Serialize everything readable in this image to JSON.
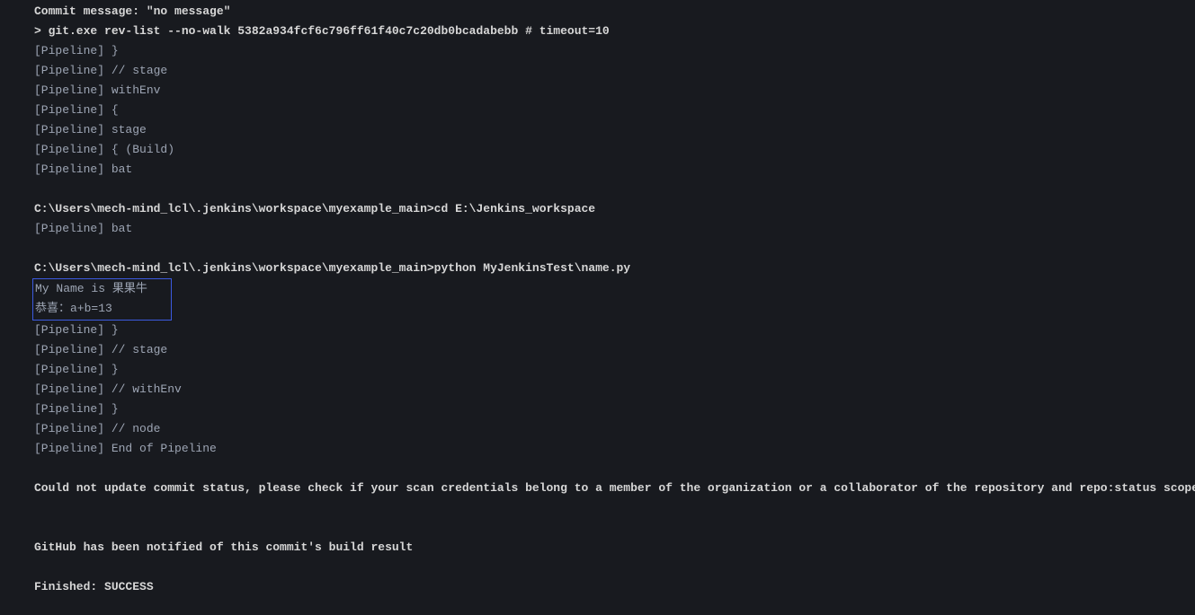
{
  "console": {
    "lines": [
      {
        "text": "Commit message: \"no message\"",
        "style": "bold-white"
      },
      {
        "text": " > git.exe rev-list --no-walk 5382a934fcf6c796ff61f40c7c20db0bcadabebb # timeout=10",
        "style": "bold-white"
      },
      {
        "text": "[Pipeline] }",
        "style": "normal"
      },
      {
        "text": "[Pipeline] // stage",
        "style": "normal"
      },
      {
        "text": "[Pipeline] withEnv",
        "style": "normal"
      },
      {
        "text": "[Pipeline] {",
        "style": "normal"
      },
      {
        "text": "[Pipeline] stage",
        "style": "normal"
      },
      {
        "text": "[Pipeline] { (Build)",
        "style": "normal"
      },
      {
        "text": "[Pipeline] bat",
        "style": "normal"
      },
      {
        "text": "",
        "style": "normal"
      },
      {
        "text": "C:\\Users\\mech-mind_lcl\\.jenkins\\workspace\\myexample_main>cd E:\\Jenkins_workspace ",
        "style": "bold-white"
      },
      {
        "text": "[Pipeline] bat",
        "style": "normal"
      },
      {
        "text": "",
        "style": "normal"
      },
      {
        "text": "C:\\Users\\mech-mind_lcl\\.jenkins\\workspace\\myexample_main>python MyJenkinsTest\\name.py ",
        "style": "bold-white"
      }
    ],
    "highlighted": [
      "My Name is 果果牛",
      "恭喜：a+b=13"
    ],
    "lines_after": [
      {
        "text": "[Pipeline] }",
        "style": "normal"
      },
      {
        "text": "[Pipeline] // stage",
        "style": "normal"
      },
      {
        "text": "[Pipeline] }",
        "style": "normal"
      },
      {
        "text": "[Pipeline] // withEnv",
        "style": "normal"
      },
      {
        "text": "[Pipeline] }",
        "style": "normal"
      },
      {
        "text": "[Pipeline] // node",
        "style": "normal"
      },
      {
        "text": "[Pipeline] End of Pipeline",
        "style": "normal"
      },
      {
        "text": "",
        "style": "normal"
      },
      {
        "text": "Could not update commit status, please check if your scan credentials belong to a member of the organization or a collaborator of the repository and repo:status scope is selected",
        "style": "bold-white"
      },
      {
        "text": "",
        "style": "normal"
      },
      {
        "text": "",
        "style": "normal"
      },
      {
        "text": "GitHub has been notified of this commit's build result",
        "style": "bold-white"
      },
      {
        "text": "",
        "style": "normal"
      },
      {
        "text": "Finished: SUCCESS",
        "style": "bold-white"
      }
    ]
  }
}
